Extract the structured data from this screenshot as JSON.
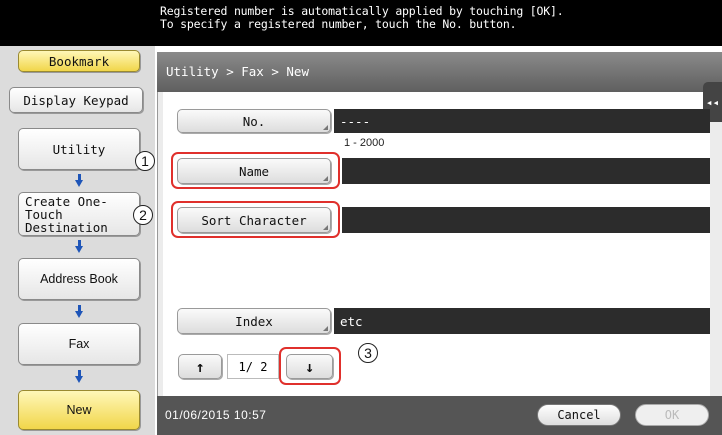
{
  "header": {
    "instruction": "Registered number is automatically applied by touching [OK].\nTo specify a registered number, touch the No. button."
  },
  "sidebar": {
    "bookmark_label": "Bookmark",
    "display_keypad_label": "Display Keypad",
    "items": [
      {
        "label": "Utility"
      },
      {
        "label": "Create One-Touch Destination"
      },
      {
        "label": "Address Book"
      },
      {
        "label": "Fax"
      },
      {
        "label": "New"
      }
    ]
  },
  "main": {
    "breadcrumb": "Utility > Fax > New",
    "fields": {
      "no_label": "No.",
      "no_value": "----",
      "no_range": "1 - 2000",
      "name_label": "Name",
      "name_value": "",
      "sort_label": "Sort Character",
      "sort_value": "",
      "index_label": "Index",
      "index_value": "etc"
    },
    "pager": {
      "up_symbol": "↑",
      "down_symbol": "↓",
      "page_text": "1/ 2"
    },
    "collapse_symbol": "◂◂"
  },
  "callouts": [
    "1",
    "2",
    "3"
  ],
  "status": {
    "timestamp": "01/06/2015  10:57",
    "cancel_label": "Cancel",
    "ok_label": "OK"
  },
  "colors": {
    "accent_yellow": "#f1d64a",
    "callout_red": "#e0302c",
    "arrow_blue": "#1e55b8"
  }
}
